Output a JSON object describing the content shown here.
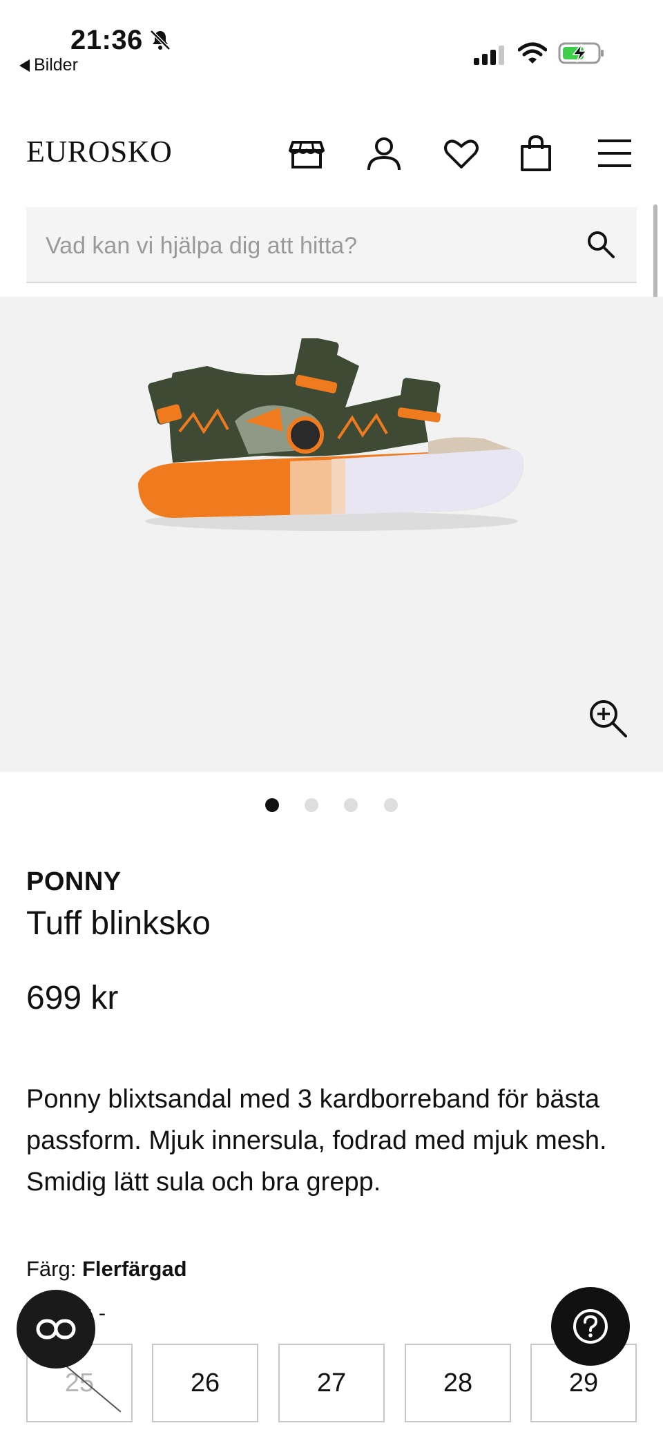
{
  "status_bar": {
    "time": "21:36",
    "back_app_label": "Bilder"
  },
  "header": {
    "logo": "EUROSKO",
    "icons": [
      "store-icon",
      "account-icon",
      "heart-icon",
      "bag-icon",
      "menu-icon"
    ]
  },
  "search": {
    "placeholder": "Vad kan vi hjälpa dig att hitta?"
  },
  "gallery": {
    "image_count": 4,
    "active_index": 0
  },
  "product": {
    "brand": "PONNY",
    "name": "Tuff blinksko",
    "price": "699 kr",
    "description": "Ponny blixtsandal med 3 kardborreband för bästa passform. Mjuk innersula, fodrad med mjuk mesh. Smidig lätt sula och bra grepp.",
    "color_label": "Färg:",
    "color_value": "Flerfärgad",
    "size_label_partial": "k: -"
  },
  "sizes": [
    {
      "label": "25",
      "available": false
    },
    {
      "label": "26",
      "available": true
    },
    {
      "label": "27",
      "available": true
    },
    {
      "label": "28",
      "available": true
    },
    {
      "label": "29",
      "available": true
    }
  ],
  "colors": {
    "accent_orange": "#f07a1e",
    "shoe_green": "#3e4a34",
    "fab_dark": "#111111"
  }
}
